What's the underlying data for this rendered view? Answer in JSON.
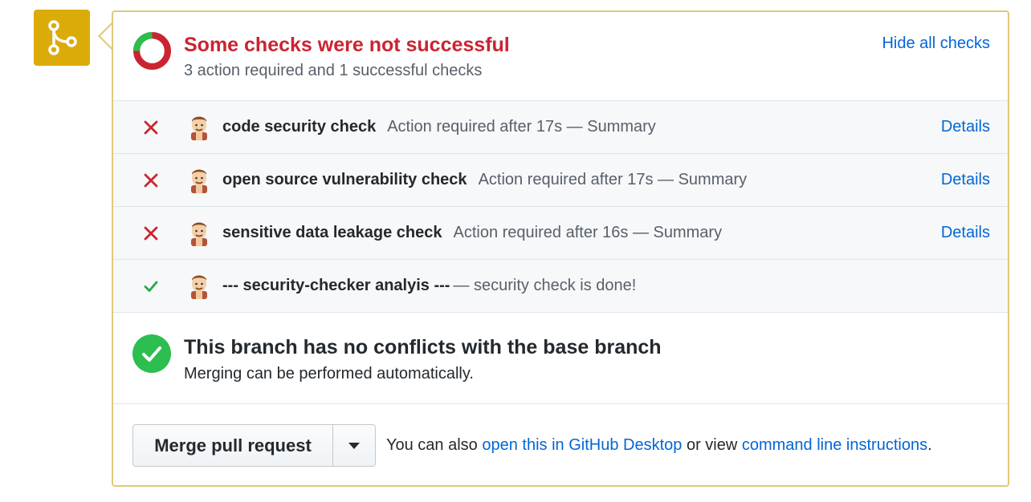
{
  "colors": {
    "merge_box": "#dbab09",
    "panel_border": "#dfc977",
    "error": "#cb2431",
    "success": "#2cbe4e",
    "link": "#0366d6",
    "muted": "#586069"
  },
  "icons": {
    "merge": "git-merge-icon",
    "status_donut": "status-donut-icon",
    "fail": "x-icon",
    "pass": "check-icon",
    "avatar": "bot-avatar-icon",
    "caret": "triangle-down-icon"
  },
  "checks_summary": {
    "title": "Some checks were not successful",
    "subtitle": "3 action required and 1 successful checks",
    "hide_link": "Hide all checks"
  },
  "checks": [
    {
      "status": "fail",
      "name": "code security check",
      "description": "Action required after 17s — Summary",
      "details": "Details"
    },
    {
      "status": "fail",
      "name": "open source vulnerability check",
      "description": "Action required after 17s — Summary",
      "details": "Details"
    },
    {
      "status": "fail",
      "name": "sensitive data leakage check",
      "description": "Action required after 16s — Summary",
      "details": "Details"
    },
    {
      "status": "pass",
      "name": "--- security-checker analyis ---",
      "description": "— security check is done!",
      "details": ""
    }
  ],
  "branch_status": {
    "title": "This branch has no conflicts with the base branch",
    "subtitle": "Merging can be performed automatically."
  },
  "merge": {
    "button_label": "Merge pull request",
    "note_prefix": "You can also ",
    "desktop_link": "open this in GitHub Desktop",
    "note_middle": " or view ",
    "cli_link": "command line instructions",
    "note_suffix": "."
  }
}
